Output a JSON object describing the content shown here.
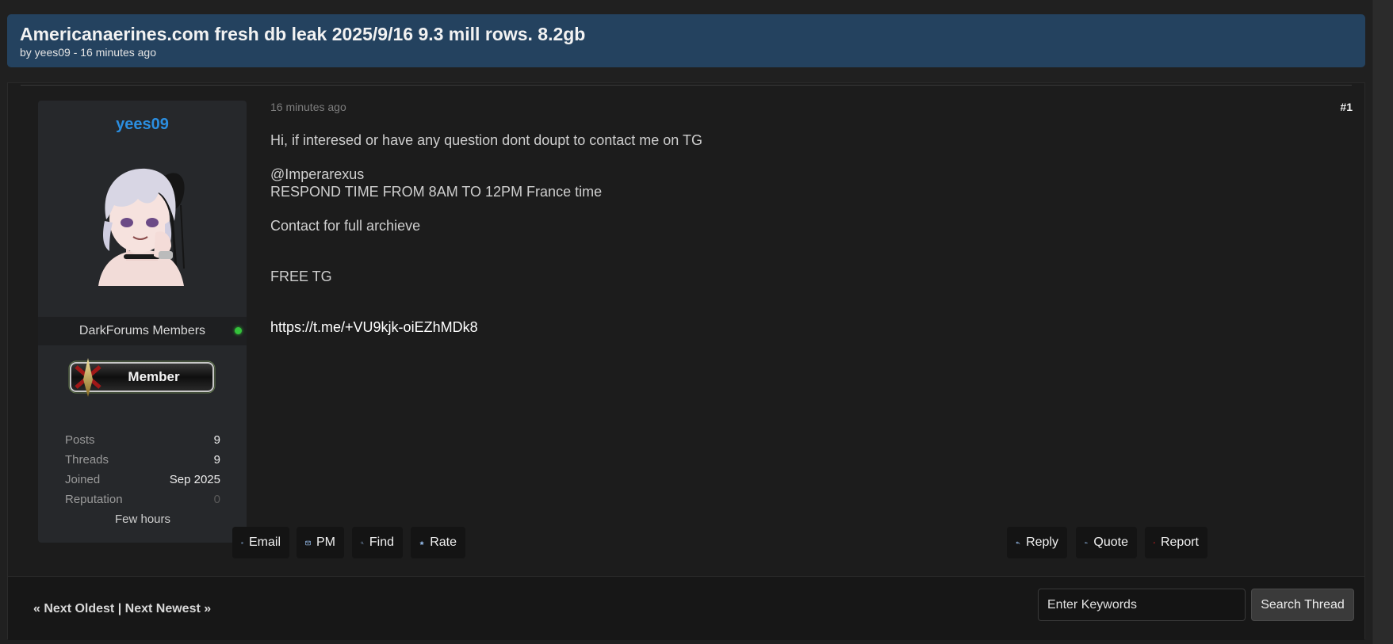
{
  "thread": {
    "title": "Americanaerines.com fresh db leak 2025/9/16 9.3 mill rows. 8.2gb",
    "byline": "by yees09 - 16 minutes ago"
  },
  "author": {
    "username": "yees09",
    "group": "DarkForums Members",
    "rank_badge": "Member",
    "stats": [
      {
        "label": "Posts",
        "value": "9"
      },
      {
        "label": "Threads",
        "value": "9"
      },
      {
        "label": "Joined",
        "value": "Sep 2025"
      },
      {
        "label": "Reputation",
        "value": "0"
      }
    ],
    "last_active": "Few hours"
  },
  "post": {
    "timestamp": "16 minutes ago",
    "number": "#1",
    "lines": [
      "Hi, if interesed or have any question dont doupt to contact me on TG",
      "@Imperarexus",
      "RESPOND TIME FROM 8AM TO 12PM France time",
      "Contact for full archieve",
      "FREE TG",
      "https://t.me/+VU9kjk-oiEZhMDk8"
    ]
  },
  "actions": {
    "email": "Email",
    "pm": "PM",
    "find": "Find",
    "rate": "Rate",
    "reply": "Reply",
    "quote": "Quote",
    "report": "Report"
  },
  "footer": {
    "next_oldest": "« Next Oldest",
    "separator": "|",
    "next_newest": "Next Newest »",
    "search_placeholder": "Enter Keywords",
    "search_button": "Search Thread"
  },
  "colors": {
    "header_bg": "#24425f",
    "username": "#2b8ee0",
    "online": "#34c23b",
    "report_flag": "#e02020",
    "icon_blue": "#8fb3e0"
  }
}
